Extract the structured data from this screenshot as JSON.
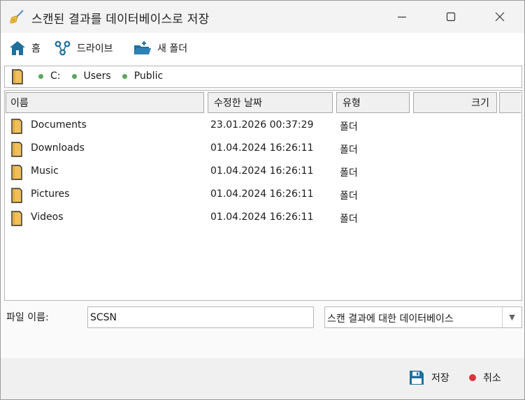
{
  "window": {
    "title": "스캔된 결과를 데이터베이스로 저장",
    "icon": "broom-icon"
  },
  "toolbar": {
    "home_label": "홈",
    "drive_label": "드라이브",
    "new_folder_label": "새 폴더"
  },
  "path": {
    "crumbs": [
      "C:",
      "Users",
      "Public"
    ]
  },
  "list": {
    "columns": [
      "이름",
      "수정한 날짜",
      "유형",
      "크기"
    ],
    "rows": [
      {
        "name": "Documents",
        "modified": "23.01.2026 00:37:29",
        "type": "폴더"
      },
      {
        "name": "Downloads",
        "modified": "01.04.2024 16:26:11",
        "type": "폴더"
      },
      {
        "name": "Music",
        "modified": "01.04.2024 16:26:11",
        "type": "폴더"
      },
      {
        "name": "Pictures",
        "modified": "01.04.2024 16:26:11",
        "type": "폴더"
      },
      {
        "name": "Videos",
        "modified": "01.04.2024 16:26:11",
        "type": "폴더"
      }
    ]
  },
  "filename": {
    "label": "파일 이름:",
    "value": "SCSN"
  },
  "filetype": {
    "selected": "스캔 결과에 대한 데이터베이스",
    "arrow": "▼"
  },
  "footer": {
    "save_label": "저장",
    "cancel_label": "취소"
  },
  "colors": {
    "accent": "#1f6e9c",
    "folder": "#f0bf5a",
    "crumb_dot": "#5aa65a",
    "cancel_dot": "#d9343f"
  }
}
